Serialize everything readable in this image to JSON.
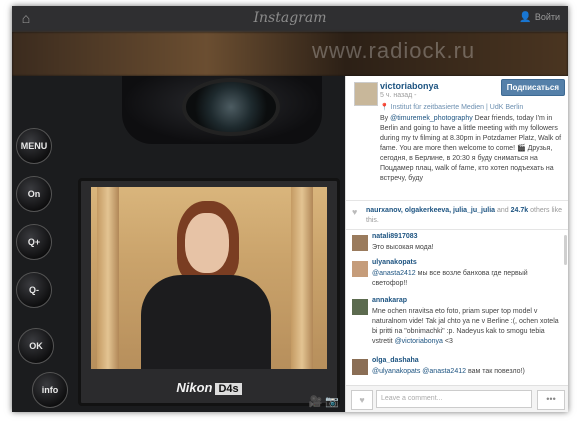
{
  "topbar": {
    "logo": "Instagram",
    "login_label": "Войти",
    "home_icon": "home-icon",
    "user_icon": "user-icon"
  },
  "watermark": "www.radiock.ru",
  "camera": {
    "buttons": [
      "MENU",
      "On",
      "Q+",
      "Q-",
      "OK",
      "info"
    ],
    "brand": "Nikon",
    "model": "D4s"
  },
  "post": {
    "username": "victoriabonya",
    "follow_label": "Подписаться",
    "time": "5 ч. назад -",
    "place": "Institut für zeitbasierte Medien | UdK Berlin",
    "caption_prefix": "By ",
    "caption_mention": "@timuremek_photography",
    "caption_text": " Dear friends, today I'm in Berlin and going to have a little meeting with my followers during my tv filming at 8.30pm in Potzdamer Platz, Walk of fame. You are more then welcome to come! 🎬 Друзья, сегодня, в Берлине, в 20:30 я буду сниматься на Поцдамер плац, walk of fame, кто хотел подъехать на встречу, буду",
    "likes_names": "naurxanov, olgakerkeeva, julia_ju_julia",
    "likes_and": " and ",
    "likes_count": "24.7k",
    "likes_suffix": " others like this.",
    "comments": [
      {
        "user": "natali8917083",
        "text": "Это высокая мода!"
      },
      {
        "user": "ulyanakopats",
        "mention": "@anasta2412",
        "text": " мы все возле банхова где первый светофор!!"
      },
      {
        "user": "annakarap",
        "text": "Mne ochen nravitsa eto foto, priam super top model v naturalnom vide! Tak jal chto ya ne v Berline :(, ochen xotela bi pritti na \"obnimachki\" :p. Nadeyus kak to smogu tebia vstretit ",
        "mention": "@victoriabonya",
        "suffix": " <3"
      },
      {
        "user": "olga_dashaha",
        "mention": "@ulyanakopats @anasta2412",
        "text": " вам так повезло!)"
      }
    ],
    "comment_placeholder": "Leave a comment...",
    "more_label": "•••"
  }
}
